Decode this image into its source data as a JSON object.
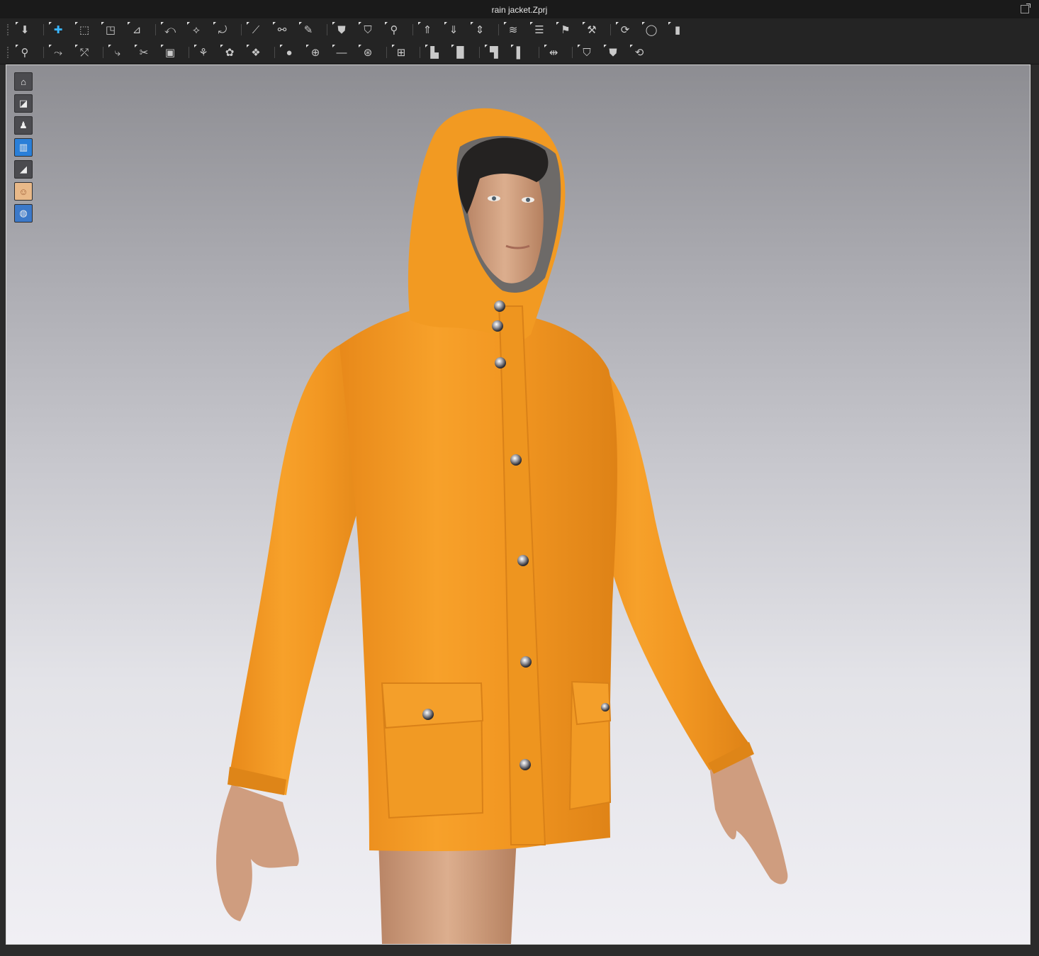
{
  "window": {
    "title": "rain jacket.Zprj"
  },
  "toolbar_row1": [
    {
      "name": "simulation-icon",
      "glyph": "⬇"
    },
    {
      "name": "select-move-icon",
      "glyph": "✚"
    },
    {
      "name": "transform-pattern-icon",
      "glyph": "⬚"
    },
    {
      "name": "transform-points-icon",
      "glyph": "◳"
    },
    {
      "name": "edit-texture-icon",
      "glyph": "⊿"
    },
    {
      "name": "edit-curvature-icon",
      "glyph": "⤺"
    },
    {
      "name": "edit-curve-point-icon",
      "glyph": "⟡"
    },
    {
      "name": "edit-sewing-icon",
      "glyph": "⤾"
    },
    {
      "name": "segment-sewing-icon",
      "glyph": "⟋"
    },
    {
      "name": "free-sewing-icon",
      "glyph": "⚯"
    },
    {
      "name": "tack-icon",
      "glyph": "✎"
    },
    {
      "name": "fold-arrangement-icon",
      "glyph": "⛊"
    },
    {
      "name": "arrangement-icon",
      "glyph": "⛉"
    },
    {
      "name": "reset-arrangement-icon",
      "glyph": "⚲"
    },
    {
      "name": "garment-up-icon",
      "glyph": "⇑"
    },
    {
      "name": "garment-down-icon",
      "glyph": "⇓"
    },
    {
      "name": "flatten-icon",
      "glyph": "⇕"
    },
    {
      "name": "layer-icon",
      "glyph": "≋"
    },
    {
      "name": "layer-stack-icon",
      "glyph": "☰"
    },
    {
      "name": "pin-icon",
      "glyph": "⚑"
    },
    {
      "name": "strengthen-icon",
      "glyph": "⚒"
    },
    {
      "name": "measure-icon",
      "glyph": "⟳"
    },
    {
      "name": "tape-icon",
      "glyph": "◯"
    },
    {
      "name": "ruler-icon",
      "glyph": "▮"
    }
  ],
  "toolbar_row2": [
    {
      "name": "avatar-pose-icon",
      "glyph": "⚲"
    },
    {
      "name": "create-seam-icon",
      "glyph": "⤳"
    },
    {
      "name": "create-seamline-icon",
      "glyph": "⤱"
    },
    {
      "name": "fold-line-icon",
      "glyph": "⤷"
    },
    {
      "name": "cut-line-icon",
      "glyph": "✂"
    },
    {
      "name": "puckering-icon",
      "glyph": "▣"
    },
    {
      "name": "graphic-icon",
      "glyph": "⚘"
    },
    {
      "name": "texture-icon",
      "glyph": "✿"
    },
    {
      "name": "pattern-texture-icon",
      "glyph": "❖"
    },
    {
      "name": "button-icon",
      "glyph": "●"
    },
    {
      "name": "buttonhole-icon",
      "glyph": "⊕"
    },
    {
      "name": "topstitch-icon",
      "glyph": "—"
    },
    {
      "name": "fasten-icon",
      "glyph": "⊛"
    },
    {
      "name": "zipper-icon",
      "glyph": "⊞"
    },
    {
      "name": "piping-icon",
      "glyph": "▙"
    },
    {
      "name": "elastic-icon",
      "glyph": "▉"
    },
    {
      "name": "fold-icon",
      "glyph": "▜"
    },
    {
      "name": "shirring-icon",
      "glyph": "▌"
    },
    {
      "name": "trim-icon",
      "glyph": "⇹"
    },
    {
      "name": "show-garment-icon",
      "glyph": "⛉"
    },
    {
      "name": "show-avatar-icon",
      "glyph": "⛊"
    },
    {
      "name": "turntable-icon",
      "glyph": "⟲"
    }
  ],
  "viewport_sidebar": [
    {
      "name": "garment-display-icon",
      "glyph": "⌂"
    },
    {
      "name": "texture-display-icon",
      "glyph": "◪"
    },
    {
      "name": "avatar-display-icon",
      "glyph": "♟"
    },
    {
      "name": "render-mode-icon",
      "glyph": "▥"
    },
    {
      "name": "shading-icon",
      "glyph": "◢"
    },
    {
      "name": "skin-icon",
      "glyph": "☺"
    },
    {
      "name": "world-icon",
      "glyph": "◍"
    }
  ],
  "colors": {
    "jacket": "#f39a1e",
    "skin": "#d6a787",
    "hair": "#232222",
    "snap": "#d9d9de"
  }
}
